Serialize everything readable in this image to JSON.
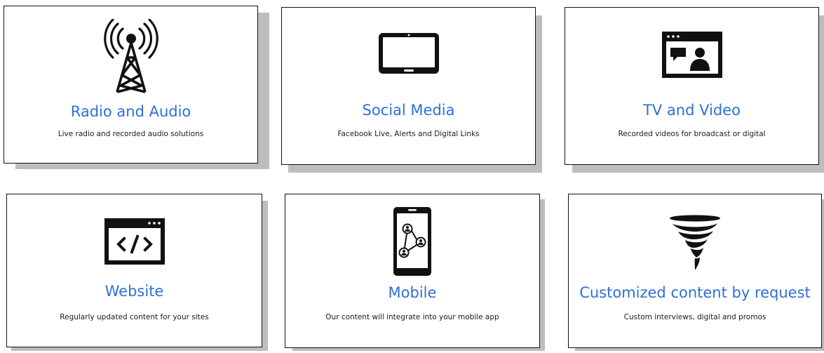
{
  "cards": [
    {
      "title": "Radio and Audio",
      "description": "Live radio and recorded audio solutions",
      "icon": "radio-tower-icon"
    },
    {
      "title": "Social Media",
      "description": "Facebook Live, Alerts and Digital Links",
      "icon": "tablet-icon"
    },
    {
      "title": "TV and Video",
      "description": "Recorded videos for broadcast or digital",
      "icon": "video-window-icon"
    },
    {
      "title": "Website",
      "description": "Regularly updated content for your sites",
      "icon": "code-window-icon"
    },
    {
      "title": "Mobile",
      "description": "Our content will integrate into your mobile app",
      "icon": "mobile-network-icon"
    },
    {
      "title": "Customized content by request",
      "description": "Custom interviews, digital and promos",
      "icon": "tornado-icon"
    }
  ],
  "colors": {
    "title": "#2f6fd6",
    "shadow": "#bdbdbd",
    "border": "#111111"
  }
}
